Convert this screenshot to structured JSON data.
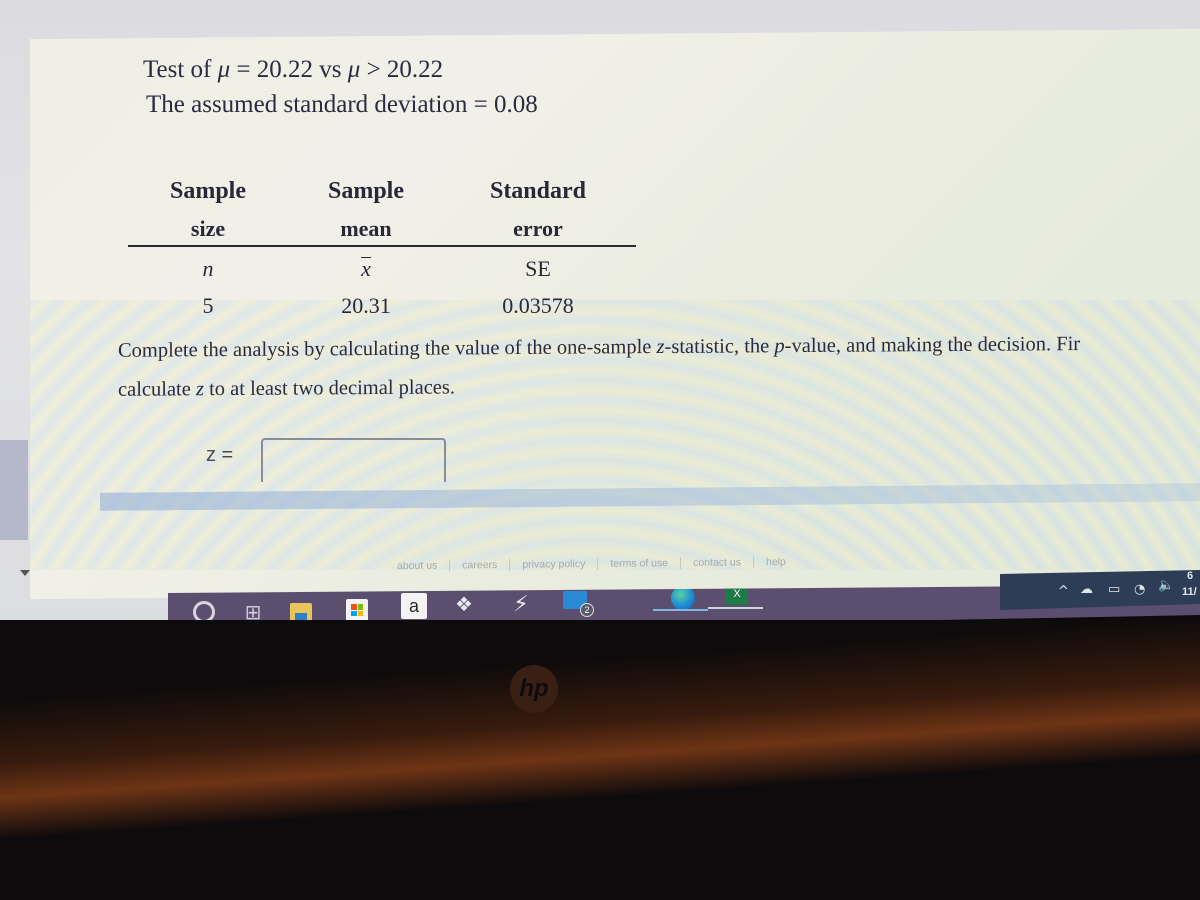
{
  "problem": {
    "hypothesis": {
      "prefix": "Test of ",
      "mu_symbol": "μ",
      "null_text": " = 20.22 vs ",
      "alt_text": " > 20.22"
    },
    "assumed_sd_text": "The assumed standard deviation = 0.08"
  },
  "stats_table": {
    "headers": [
      {
        "line1": "Sample",
        "line2": "size",
        "symbol": "n",
        "value": "5"
      },
      {
        "line1": "Sample",
        "line2": "mean",
        "symbol": "x",
        "value": "20.31"
      },
      {
        "line1": "Standard",
        "line2": "error",
        "symbol": "SE",
        "value": "0.03578"
      }
    ]
  },
  "instructions": {
    "line1_a": "Complete the analysis by calculating the value of the one-sample ",
    "line1_z": "z",
    "line1_b": "-statistic, the ",
    "line1_p": "p",
    "line1_c": "-value, and making the decision. Fir",
    "line2_a": "calculate ",
    "line2_z": "z",
    "line2_b": " to at least two decimal places."
  },
  "answer": {
    "label": "z =",
    "value": "",
    "placeholder": ""
  },
  "footer_links": [
    "about us",
    "careers",
    "privacy policy",
    "terms of use",
    "contact us",
    "help"
  ],
  "taskbar": {
    "apps": [
      "cortana",
      "task-view",
      "file-explorer",
      "microsoft-store",
      "amazon",
      "dropbox",
      "bolt-app",
      "mail",
      "edge",
      "excel"
    ],
    "amazon_glyph": "a",
    "excel_glyph": "X",
    "mail_badge": "2",
    "taskview_glyph": "⊞",
    "dropbox_glyph": "❖",
    "bolt_glyph": "⚡"
  },
  "tray": {
    "chevron": "^",
    "cloud": "☁",
    "battery": "▭",
    "wifi": "◔",
    "volume": "🔈",
    "time": "6",
    "date": "11/"
  },
  "bezel": {
    "brand": "hp"
  }
}
